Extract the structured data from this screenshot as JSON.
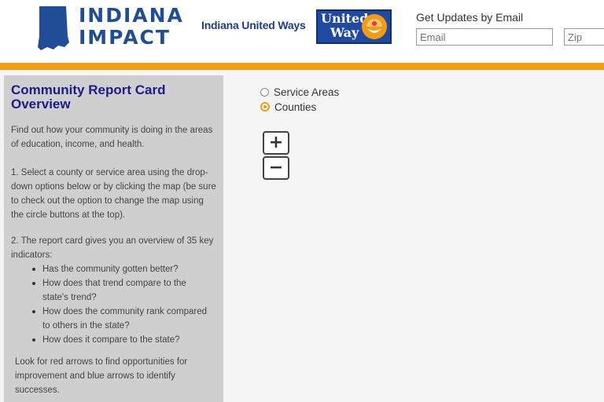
{
  "header": {
    "logo_line1": "INDIANA",
    "logo_line2": "IMPACT",
    "partner_name": "Indiana United Ways",
    "uw_logo_line1": "United",
    "uw_logo_line2": "Way",
    "updates_label": "Get Updates by Email",
    "email_placeholder": "Email",
    "zip_placeholder": "Zip",
    "brand_color": "#1f4e96",
    "accent_color": "#f39c12"
  },
  "sidebar": {
    "title": "Community Report Card Overview",
    "intro": "Find out how your community is doing in the areas of education, income, and health.",
    "step1": "1.  Select a county or service area using the drop-down options below or by clicking the map (be sure to check out the option to change the map using the circle buttons at the top).",
    "step2": "2.  The report card gives you an overview of 35 key indicators:",
    "questions": [
      "Has the community gotten better?",
      "How does that trend compare to the state's trend?",
      "How does the community rank compared to others in the state?",
      "How does it compare to the state?"
    ],
    "footer": "Look for red arrows to find opportunities for improvement and blue arrows to identify successes."
  },
  "map": {
    "radio_options": [
      {
        "label": "Service Areas",
        "selected": false
      },
      {
        "label": "Counties",
        "selected": true
      }
    ],
    "zoom_in": "+",
    "zoom_out": "−"
  }
}
